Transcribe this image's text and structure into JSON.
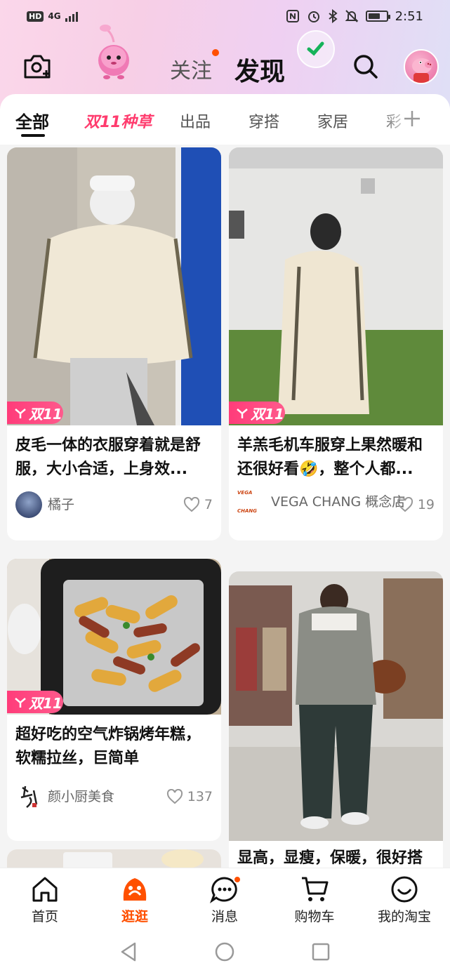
{
  "status_bar": {
    "hd": "HD",
    "network": "4G",
    "time": "2:51",
    "battery_level": 0.7
  },
  "header": {
    "follow_label": "关注",
    "discover_label": "发现"
  },
  "categories": [
    "全部",
    "双11种草",
    "出品",
    "穿搭",
    "家居",
    "彩"
  ],
  "cards": [
    {
      "badge": "双11",
      "title_line1": "皮毛一体的衣服穿着就是舒",
      "title_line2": "服，大小合适，上身效...",
      "author": "橘子",
      "likes": "7"
    },
    {
      "badge": "双11",
      "title_line1": "羊羔毛机车服穿上果然暖和",
      "title_line2": "还很好看🤣，整个人都...",
      "author_logo": "VEGA CHANG",
      "author": "VEGA CHANG 概念店",
      "likes": "19"
    },
    {
      "badge": "双11",
      "title_line1": "超好吃的空气炸锅烤年糕，",
      "title_line2": "软糯拉丝，巨简单",
      "author": "颜小厨美食",
      "likes": "137"
    },
    {
      "title_line1": "显高，显瘦，保暖，很好搭"
    }
  ],
  "bottom_nav": [
    {
      "label": "首页",
      "icon": "home-icon"
    },
    {
      "label": "逛逛",
      "icon": "guangguang-icon"
    },
    {
      "label": "消息",
      "icon": "message-icon"
    },
    {
      "label": "购物车",
      "icon": "cart-icon"
    },
    {
      "label": "我的淘宝",
      "icon": "profile-icon"
    }
  ],
  "colors": {
    "accent": "#ff5000",
    "promo": "#ff3c6e"
  }
}
